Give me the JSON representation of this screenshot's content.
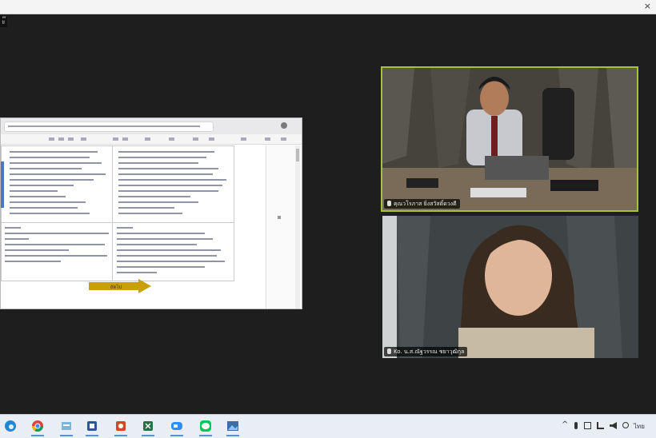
{
  "window": {
    "close_glyph": "×",
    "corner_label": "ะ๊"
  },
  "participants": [
    {
      "name": "คุณวโรภาส ยิ่งสวัสดิ์ดวงดี"
    },
    {
      "name": "Ko. น.ส.ณัฐวรรณ ชยาวุฒิกุล"
    }
  ],
  "shared_screen": {
    "arrow_label": "ถัดไป"
  },
  "taskbar": {
    "apps": [
      "edge-icon",
      "chrome-icon",
      "files-icon",
      "word-icon",
      "powerpoint-icon",
      "excel-icon",
      "zoom-icon",
      "line-icon",
      "photos-icon"
    ],
    "tray_text": "ไทย",
    "tray_chevron": "^"
  },
  "colors": {
    "active_speaker_border": "#a6c23a",
    "background": "#1e1e1e",
    "taskbar": "#e9eef4"
  }
}
